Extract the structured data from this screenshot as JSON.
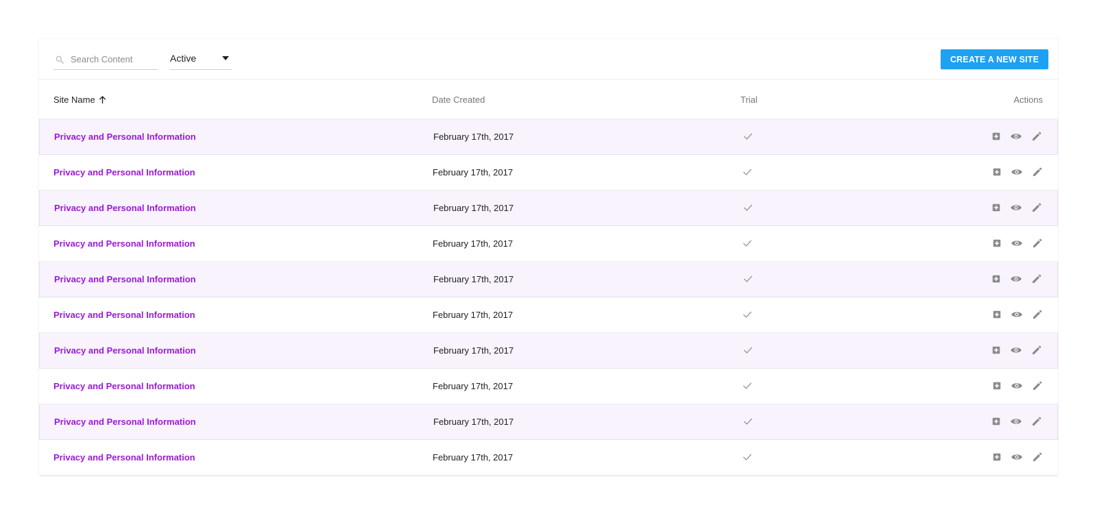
{
  "toolbar": {
    "search_placeholder": "Search Content",
    "search_value": "",
    "status_filter": "Active",
    "create_button_label": "CREATE A NEW SITE"
  },
  "table": {
    "columns": {
      "site_name": "Site Name",
      "date_created": "Date Created",
      "trial": "Trial",
      "actions": "Actions"
    },
    "sort": {
      "column": "Site Name",
      "direction": "ascending"
    },
    "rows": [
      {
        "name": "Privacy and Personal Information",
        "date": "February 17th, 2017",
        "trial": true
      },
      {
        "name": "Privacy and Personal Information",
        "date": "February 17th, 2017",
        "trial": true
      },
      {
        "name": "Privacy and Personal Information",
        "date": "February 17th, 2017",
        "trial": true
      },
      {
        "name": "Privacy and Personal Information",
        "date": "February 17th, 2017",
        "trial": true
      },
      {
        "name": "Privacy and Personal Information",
        "date": "February 17th, 2017",
        "trial": true
      },
      {
        "name": "Privacy and Personal Information",
        "date": "February 17th, 2017",
        "trial": true
      },
      {
        "name": "Privacy and Personal Information",
        "date": "February 17th, 2017",
        "trial": true
      },
      {
        "name": "Privacy and Personal Information",
        "date": "February 17th, 2017",
        "trial": true
      },
      {
        "name": "Privacy and Personal Information",
        "date": "February 17th, 2017",
        "trial": true
      },
      {
        "name": "Privacy and Personal Information",
        "date": "February 17th, 2017",
        "trial": true
      }
    ],
    "row_actions": [
      "add-box-icon",
      "eye-icon",
      "pencil-icon"
    ]
  },
  "colors": {
    "accent_button": "#1da1f2",
    "link_purple": "#9b19d8",
    "alt_row_bg": "#f8f3fd",
    "icon_gray": "#8a8a8a"
  }
}
